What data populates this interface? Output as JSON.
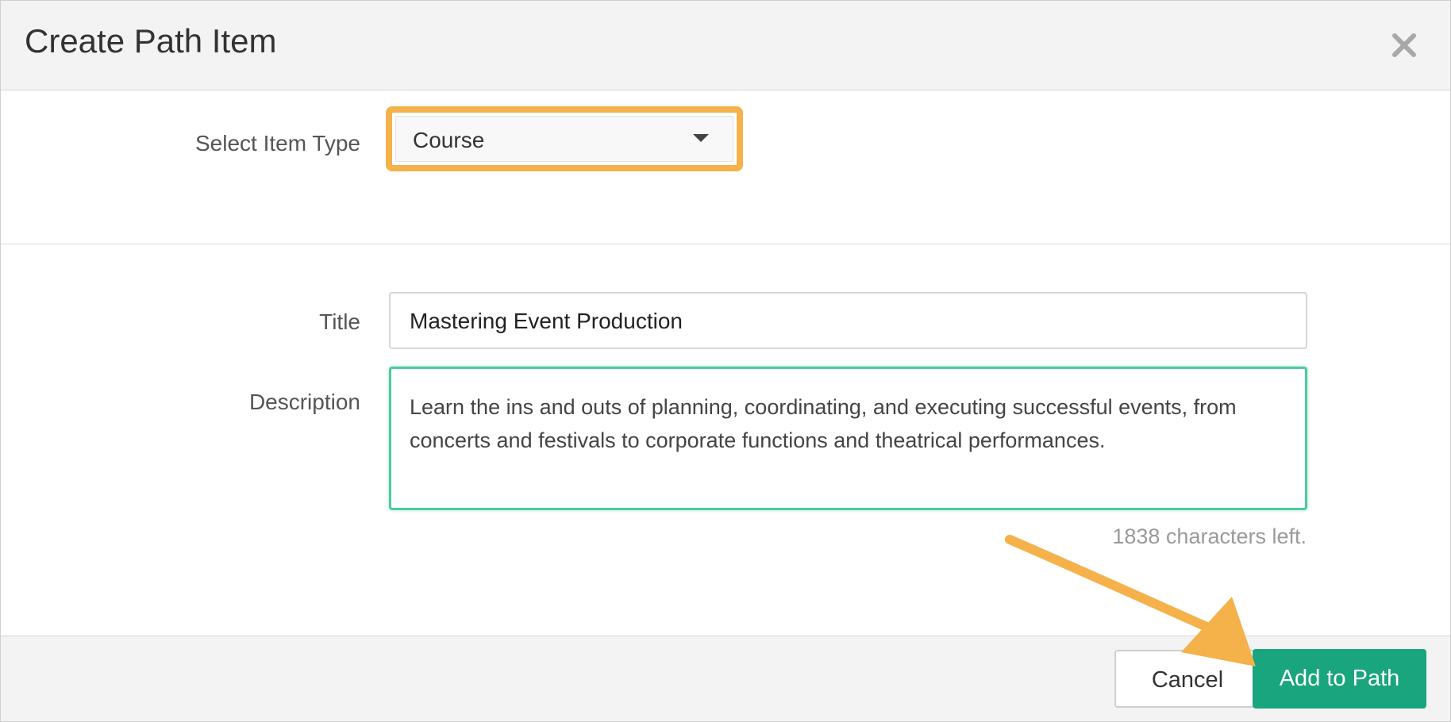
{
  "dialog": {
    "title": "Create Path Item",
    "close_icon": "close-icon"
  },
  "item_type": {
    "label": "Select Item Type",
    "selected": "Course",
    "caret_icon": "caret-down-icon"
  },
  "form": {
    "title_label": "Title",
    "title_value": "Mastering Event Production",
    "description_label": "Description",
    "description_value": "Learn the ins and outs of planning, coordinating, and executing successful events, from concerts and festivals to corporate functions and theatrical performances.",
    "char_count": "1838 characters left."
  },
  "footer": {
    "cancel_label": "Cancel",
    "add_label": "Add to Path"
  },
  "colors": {
    "highlight": "#f5b14a",
    "primary": "#19a57d",
    "focus": "#4ecb9e"
  }
}
